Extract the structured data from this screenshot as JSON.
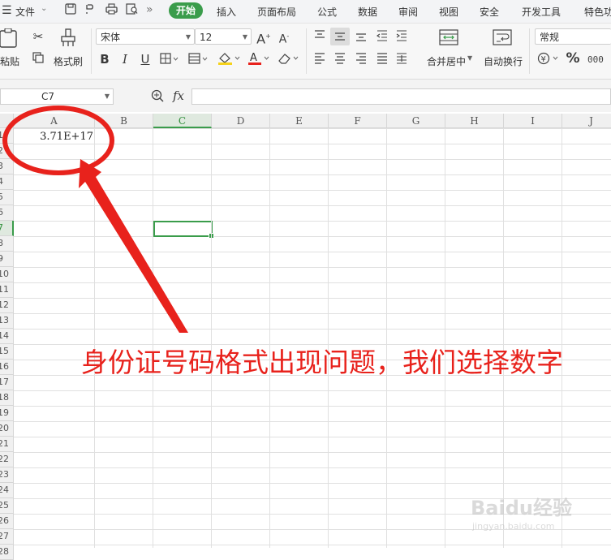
{
  "menu": {
    "file": "文件",
    "tabs": [
      "开始",
      "插入",
      "页面布局",
      "公式",
      "数据",
      "审阅",
      "视图",
      "安全",
      "开发工具",
      "特色功"
    ]
  },
  "ribbon": {
    "paste_label": "粘贴",
    "format_painter_label": "格式刷",
    "font_name": "宋体",
    "font_size": "12",
    "merge_label": "合并居中",
    "wrap_label": "自动换行",
    "number_format": "常规",
    "percent": "%",
    "bold": "B",
    "italic": "I",
    "underline": "U"
  },
  "formula_bar": {
    "name_box": "C7",
    "fx": "fx",
    "content": ""
  },
  "grid": {
    "columns": [
      "A",
      "B",
      "C",
      "D",
      "E",
      "F",
      "G",
      "H",
      "I",
      "J"
    ],
    "selected_column": "C",
    "rows": [
      "1",
      "2",
      "3",
      "4",
      "5",
      "6",
      "7",
      "8",
      "9",
      "10",
      "11",
      "12",
      "13",
      "14",
      "15",
      "16",
      "17",
      "18",
      "19",
      "20",
      "21",
      "22",
      "23",
      "24",
      "25",
      "26",
      "27",
      "28"
    ],
    "selected_row": "7",
    "cell_a1": "3.71E+17"
  },
  "annotation": {
    "text": "身份证号码格式出现问题，我们选择数字",
    "color": "#e8221c"
  },
  "watermark": {
    "brand": "Baidu经验",
    "url": "jingyan.baidu.com"
  },
  "colors": {
    "accent": "#3a9c4b",
    "annotation": "#e8221c"
  }
}
